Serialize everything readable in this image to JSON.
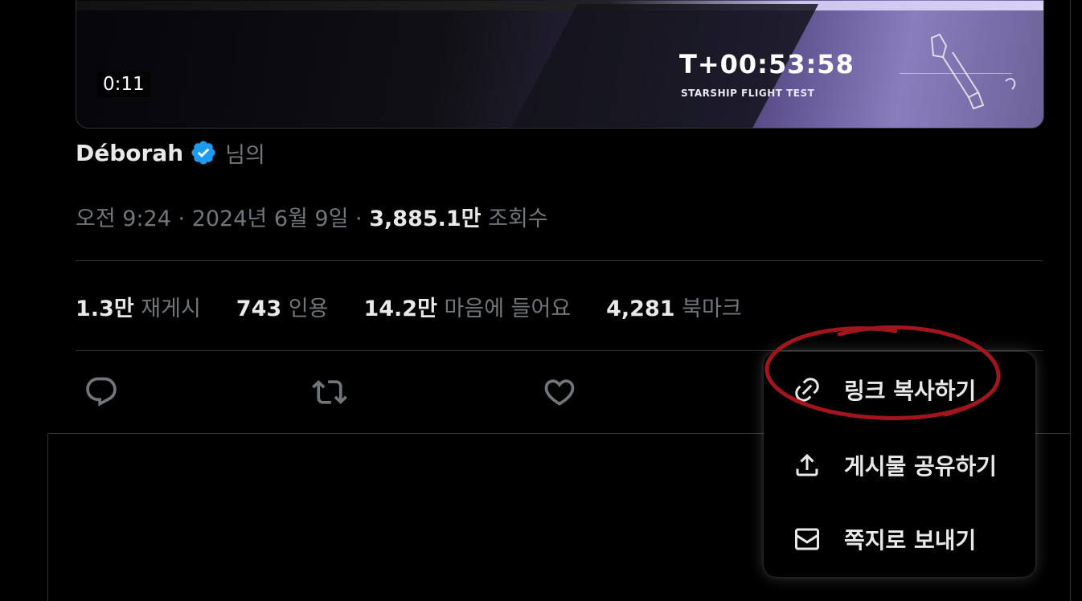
{
  "video": {
    "duration": "0:11",
    "overlay_timer": "T+00:53:58",
    "overlay_caption": "STARSHIP FLIGHT TEST"
  },
  "author": {
    "name": "Déborah",
    "suffix": "님의",
    "verified": true
  },
  "meta": {
    "time": "오전 9:24",
    "separator": "·",
    "date": "2024년 6월 9일",
    "views_count": "3,885.1만",
    "views_label": "조회수"
  },
  "stats": [
    {
      "count": "1.3만",
      "label": "재게시"
    },
    {
      "count": "743",
      "label": "인용"
    },
    {
      "count": "14.2만",
      "label": "마음에 들어요"
    },
    {
      "count": "4,281",
      "label": "북마크"
    }
  ],
  "actions": {
    "icons": [
      "reply-icon",
      "retweet-icon",
      "like-icon"
    ]
  },
  "share_menu": {
    "items": [
      {
        "label": "링크 복사하기",
        "icon": "link-icon"
      },
      {
        "label": "게시물 공유하기",
        "icon": "share-upload-icon"
      },
      {
        "label": "쪽지로 보내기",
        "icon": "envelope-icon"
      }
    ]
  },
  "colors": {
    "background": "#000000",
    "text_primary": "#e7e9ea",
    "text_secondary": "#71767b",
    "border": "#2f3336",
    "verified_blue": "#1d9bf0",
    "annotation_red": "#a0161c"
  }
}
